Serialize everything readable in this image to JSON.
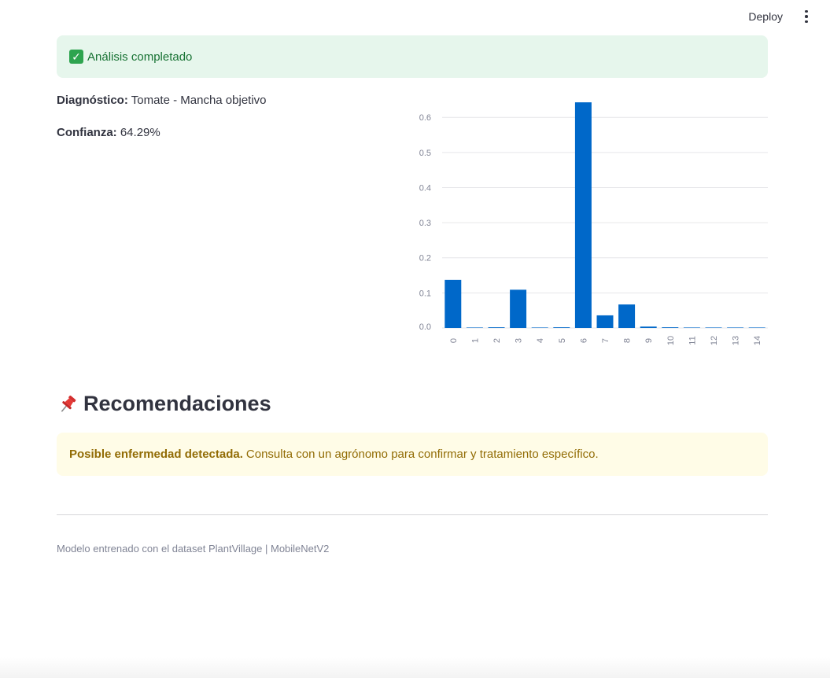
{
  "topbar": {
    "deploy_label": "Deploy",
    "menu_icon": "kebab-menu-icon"
  },
  "success": {
    "icon": "check-mark-icon",
    "message": "Análisis completado",
    "color": "#177233",
    "background": "#e6f6ec"
  },
  "result": {
    "diagnosis_label": "Diagnóstico:",
    "diagnosis_value": "Tomate - Mancha objetivo",
    "confidence_label": "Confianza:",
    "confidence_value": "64.29%"
  },
  "chart_data": {
    "type": "bar",
    "categories": [
      "0",
      "1",
      "2",
      "3",
      "4",
      "5",
      "6",
      "7",
      "8",
      "9",
      "10",
      "11",
      "12",
      "13",
      "14"
    ],
    "values": [
      0.137,
      0.0005,
      0.002,
      0.109,
      0.0003,
      0.002,
      0.6429,
      0.036,
      0.067,
      0.004,
      0.002,
      0.0005,
      0.0003,
      0.0002,
      0.0003
    ],
    "yticks": [
      0.0,
      0.1,
      0.2,
      0.3,
      0.4,
      0.5,
      0.6
    ],
    "ytick_labels": [
      "0.0",
      "0.1",
      "0.2",
      "0.3",
      "0.4",
      "0.5",
      "0.6"
    ],
    "ylim": [
      0,
      0.67
    ],
    "grid": true,
    "bar_color": "#0068c9",
    "title": "",
    "xlabel": "",
    "ylabel": ""
  },
  "recommendations": {
    "icon": "pushpin-icon",
    "title": "Recomendaciones",
    "warning_bold": "Posible enfermedad detectada.",
    "warning_text": "Consulta con un agrónomo para confirmar y tratamiento específico.",
    "warning_color": "#926c05",
    "warning_background": "#fffce7"
  },
  "footer": {
    "caption": "Modelo entrenado con el dataset PlantVillage | MobileNetV2"
  }
}
